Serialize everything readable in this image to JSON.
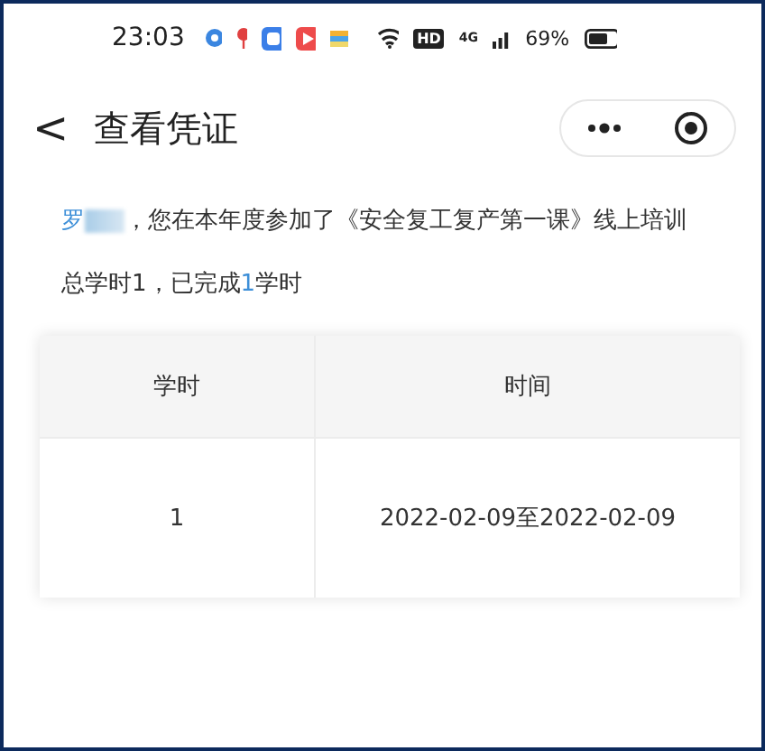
{
  "status_bar": {
    "time": "23:03",
    "hd": "HD",
    "network": "4G",
    "battery": "69%"
  },
  "header": {
    "back": "<",
    "title": "查看凭证"
  },
  "greeting": {
    "name": "罗",
    "redacted": true,
    "text": "，您在本年度参加了《安全复工复产第一课》线上培训"
  },
  "summary": {
    "before": "总学时1，已完成",
    "done": "1",
    "after": "学时"
  },
  "table": {
    "columns": [
      "学时",
      "时间"
    ],
    "rows": [
      [
        "1",
        "2022-02-09至2022-02-09"
      ]
    ]
  }
}
